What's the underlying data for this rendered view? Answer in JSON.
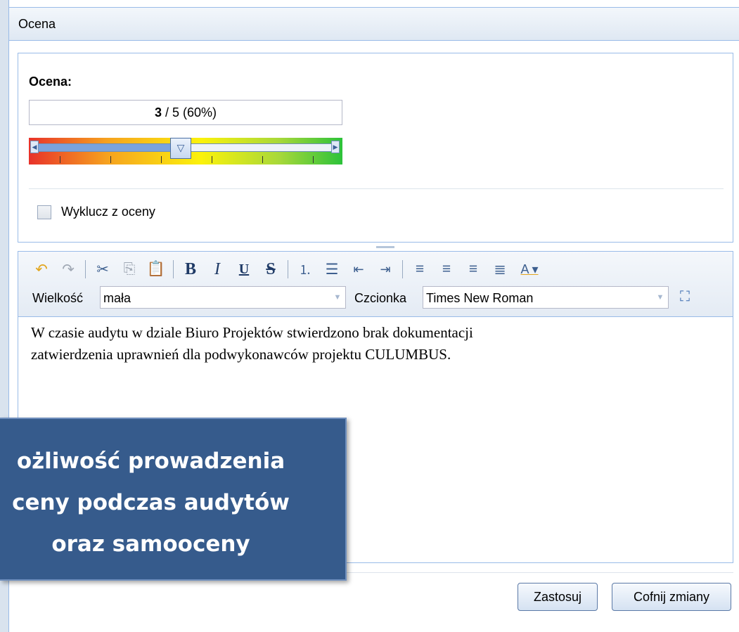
{
  "window": {
    "title": "Ocena"
  },
  "rating": {
    "label": "Ocena:",
    "value_bold": "3",
    "value_rest": " / 5 (60%)",
    "value": 3,
    "max": 5,
    "percent": 60,
    "gradient_colors": [
      "#e8322a",
      "#f6a21f",
      "#fbf20c",
      "#a7d83a",
      "#2cc23a"
    ]
  },
  "exclude": {
    "label": "Wyklucz z oceny",
    "checked": false
  },
  "toolbar": {
    "icons": [
      "undo-icon",
      "redo-icon",
      "cut-icon",
      "copy-icon",
      "paste-icon",
      "bold-icon",
      "italic-icon",
      "underline-icon",
      "strikethrough-icon",
      "ordered-list-icon",
      "unordered-list-icon",
      "outdent-icon",
      "indent-icon",
      "align-left-icon",
      "align-right-icon",
      "align-center-icon",
      "justify-icon",
      "font-color-icon"
    ],
    "size_label": "Wielkość",
    "size_value": "mała",
    "font_label": "Czcionka",
    "font_value": "Times New Roman"
  },
  "editor": {
    "line1": "W czasie audytu w dziale Biuro Projektów stwierdzono brak dokumentacji",
    "line2": "zatwierdzenia uprawnień dla podwykonawców projektu CULUMBUS."
  },
  "buttons": {
    "apply": "Zastosuj",
    "revert": "Cofnij zmiany"
  },
  "overlay": {
    "line1": "ożliwość prowadzenia",
    "line2": "ceny podczas audytów",
    "line3": "oraz samooceny"
  }
}
